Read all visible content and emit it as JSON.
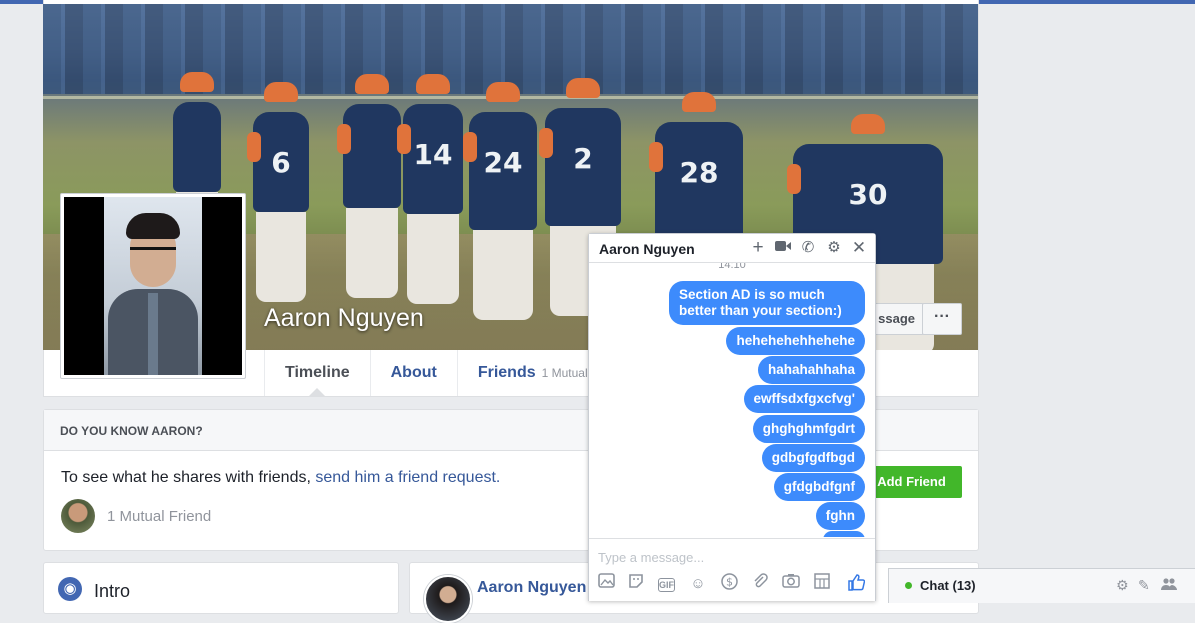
{
  "profile": {
    "name": "Aaron Nguyen"
  },
  "cover_actions": {
    "message_label": "Message",
    "message_visible": "ssage",
    "more_label": "···"
  },
  "tabs": [
    {
      "label": "Timeline"
    },
    {
      "label": "About"
    },
    {
      "label": "Friends",
      "sub": "1 Mutual"
    }
  ],
  "jerseys": [
    "24",
    "2",
    "28",
    "30",
    "6",
    "14"
  ],
  "know_card": {
    "header": "DO YOU KNOW AARON?",
    "text": "To see what he shares with friends, ",
    "link": "send him a friend request.",
    "mutual": "1 Mutual Friend",
    "add_friend": "Add Friend"
  },
  "intro": {
    "title": "Intro"
  },
  "post": {
    "name": "Aaron Nguyen"
  },
  "chat": {
    "title": "Aaron Nguyen",
    "timestamp": "14:10",
    "messages": [
      "Section AD is so much better than your section:)",
      "hehehehehhehehe",
      "hahahahhaha",
      "ewffsdxfgxcfvg'",
      "ghghghmfgdrt",
      "gdbgfgdfbgd",
      "gfdgbdfgnf",
      "fghn"
    ],
    "input_placeholder": "Type a message..."
  },
  "chatbar": {
    "label": "Chat (13)"
  },
  "colors": {
    "accent": "#4267b2",
    "link": "#365899",
    "bubble": "#3d8bfc",
    "add_friend": "#42b72a"
  },
  "icons": [
    "add-icon",
    "video-icon",
    "phone-icon",
    "gear-icon",
    "close-icon",
    "photo-icon",
    "sticker-icon",
    "gif-icon",
    "emoji-icon",
    "payment-icon",
    "attach-icon",
    "camera-icon",
    "games-icon",
    "like-icon",
    "globe-icon",
    "online-dot-icon",
    "compose-icon",
    "group-icon"
  ]
}
